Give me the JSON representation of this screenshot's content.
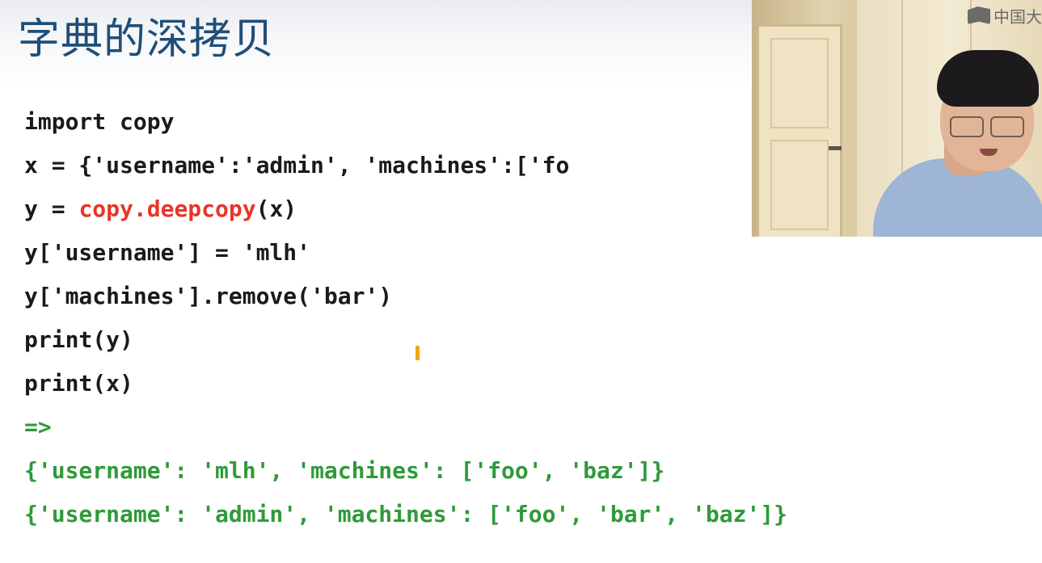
{
  "slide": {
    "title": "字典的深拷贝"
  },
  "code": {
    "lines": [
      {
        "parts": [
          "import copy"
        ]
      },
      {
        "parts": [
          "x = {'username':'admin', 'machines':['fo"
        ]
      },
      {
        "parts": [
          "y = ",
          "copy.deepcopy",
          "(x)"
        ]
      },
      {
        "parts": [
          "y['username'] = 'mlh'"
        ]
      },
      {
        "parts": [
          "y['machines'].remove('bar')"
        ]
      },
      {
        "parts": [
          "print(y)"
        ]
      },
      {
        "parts": [
          "print(x)"
        ]
      },
      {
        "parts": [
          "=>"
        ]
      },
      {
        "parts": [
          "{'username': 'mlh', 'machines': ['foo', 'baz']}"
        ]
      },
      {
        "parts": [
          "{'username': 'admin', 'machines': ['foo', 'bar', 'baz']}"
        ]
      }
    ]
  },
  "colors": {
    "title": "#1f4e79",
    "highlight": "#e8352a",
    "output": "#2f9a3a"
  },
  "video": {
    "watermark_text": "中国大"
  }
}
